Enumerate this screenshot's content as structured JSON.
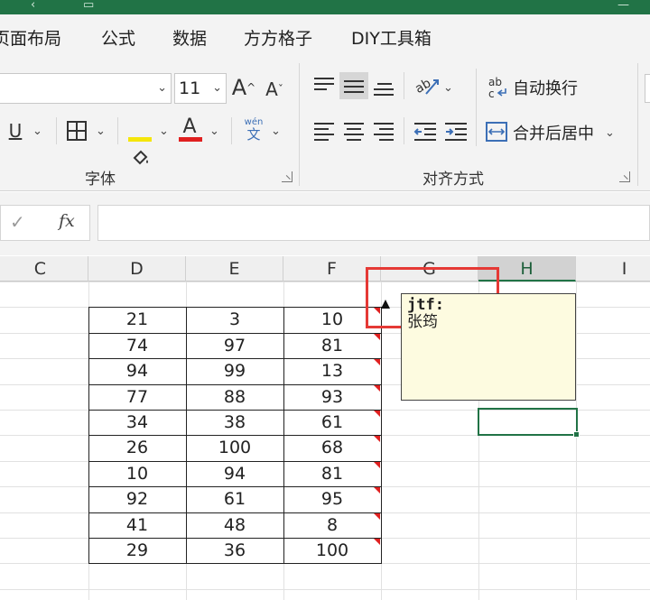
{
  "menu": {
    "tabs": [
      "页面布局",
      "公式",
      "数据",
      "方方格子",
      "DIY工具箱"
    ]
  },
  "ribbon": {
    "font_size": "11",
    "grow_font": "A",
    "shrink_font": "A",
    "underline": "U",
    "fill_color_letter": "A",
    "font_color_letter": "A",
    "phonetic_top": "wén",
    "phonetic_bottom": "文",
    "wrap_text": "自动换行",
    "merge_center": "合并后居中",
    "font_group": "字体",
    "align_group": "对齐方式",
    "colors": {
      "fill": "#f5e60b",
      "font": "#e02020",
      "accent": "#217346"
    }
  },
  "formula": {
    "fx_label": "fx",
    "check": "✓",
    "value": ""
  },
  "columns": [
    "C",
    "D",
    "E",
    "F",
    "G",
    "H",
    "I"
  ],
  "active_column": "H",
  "table": {
    "rows": [
      [
        "21",
        "3",
        "10"
      ],
      [
        "74",
        "97",
        "81"
      ],
      [
        "94",
        "99",
        "13"
      ],
      [
        "77",
        "88",
        "93"
      ],
      [
        "34",
        "38",
        "61"
      ],
      [
        "26",
        "100",
        "68"
      ],
      [
        "10",
        "94",
        "81"
      ],
      [
        "92",
        "61",
        "95"
      ],
      [
        "41",
        "48",
        "8"
      ],
      [
        "29",
        "36",
        "100"
      ]
    ]
  },
  "comment": {
    "author": "jtf:",
    "text": "张筠"
  }
}
